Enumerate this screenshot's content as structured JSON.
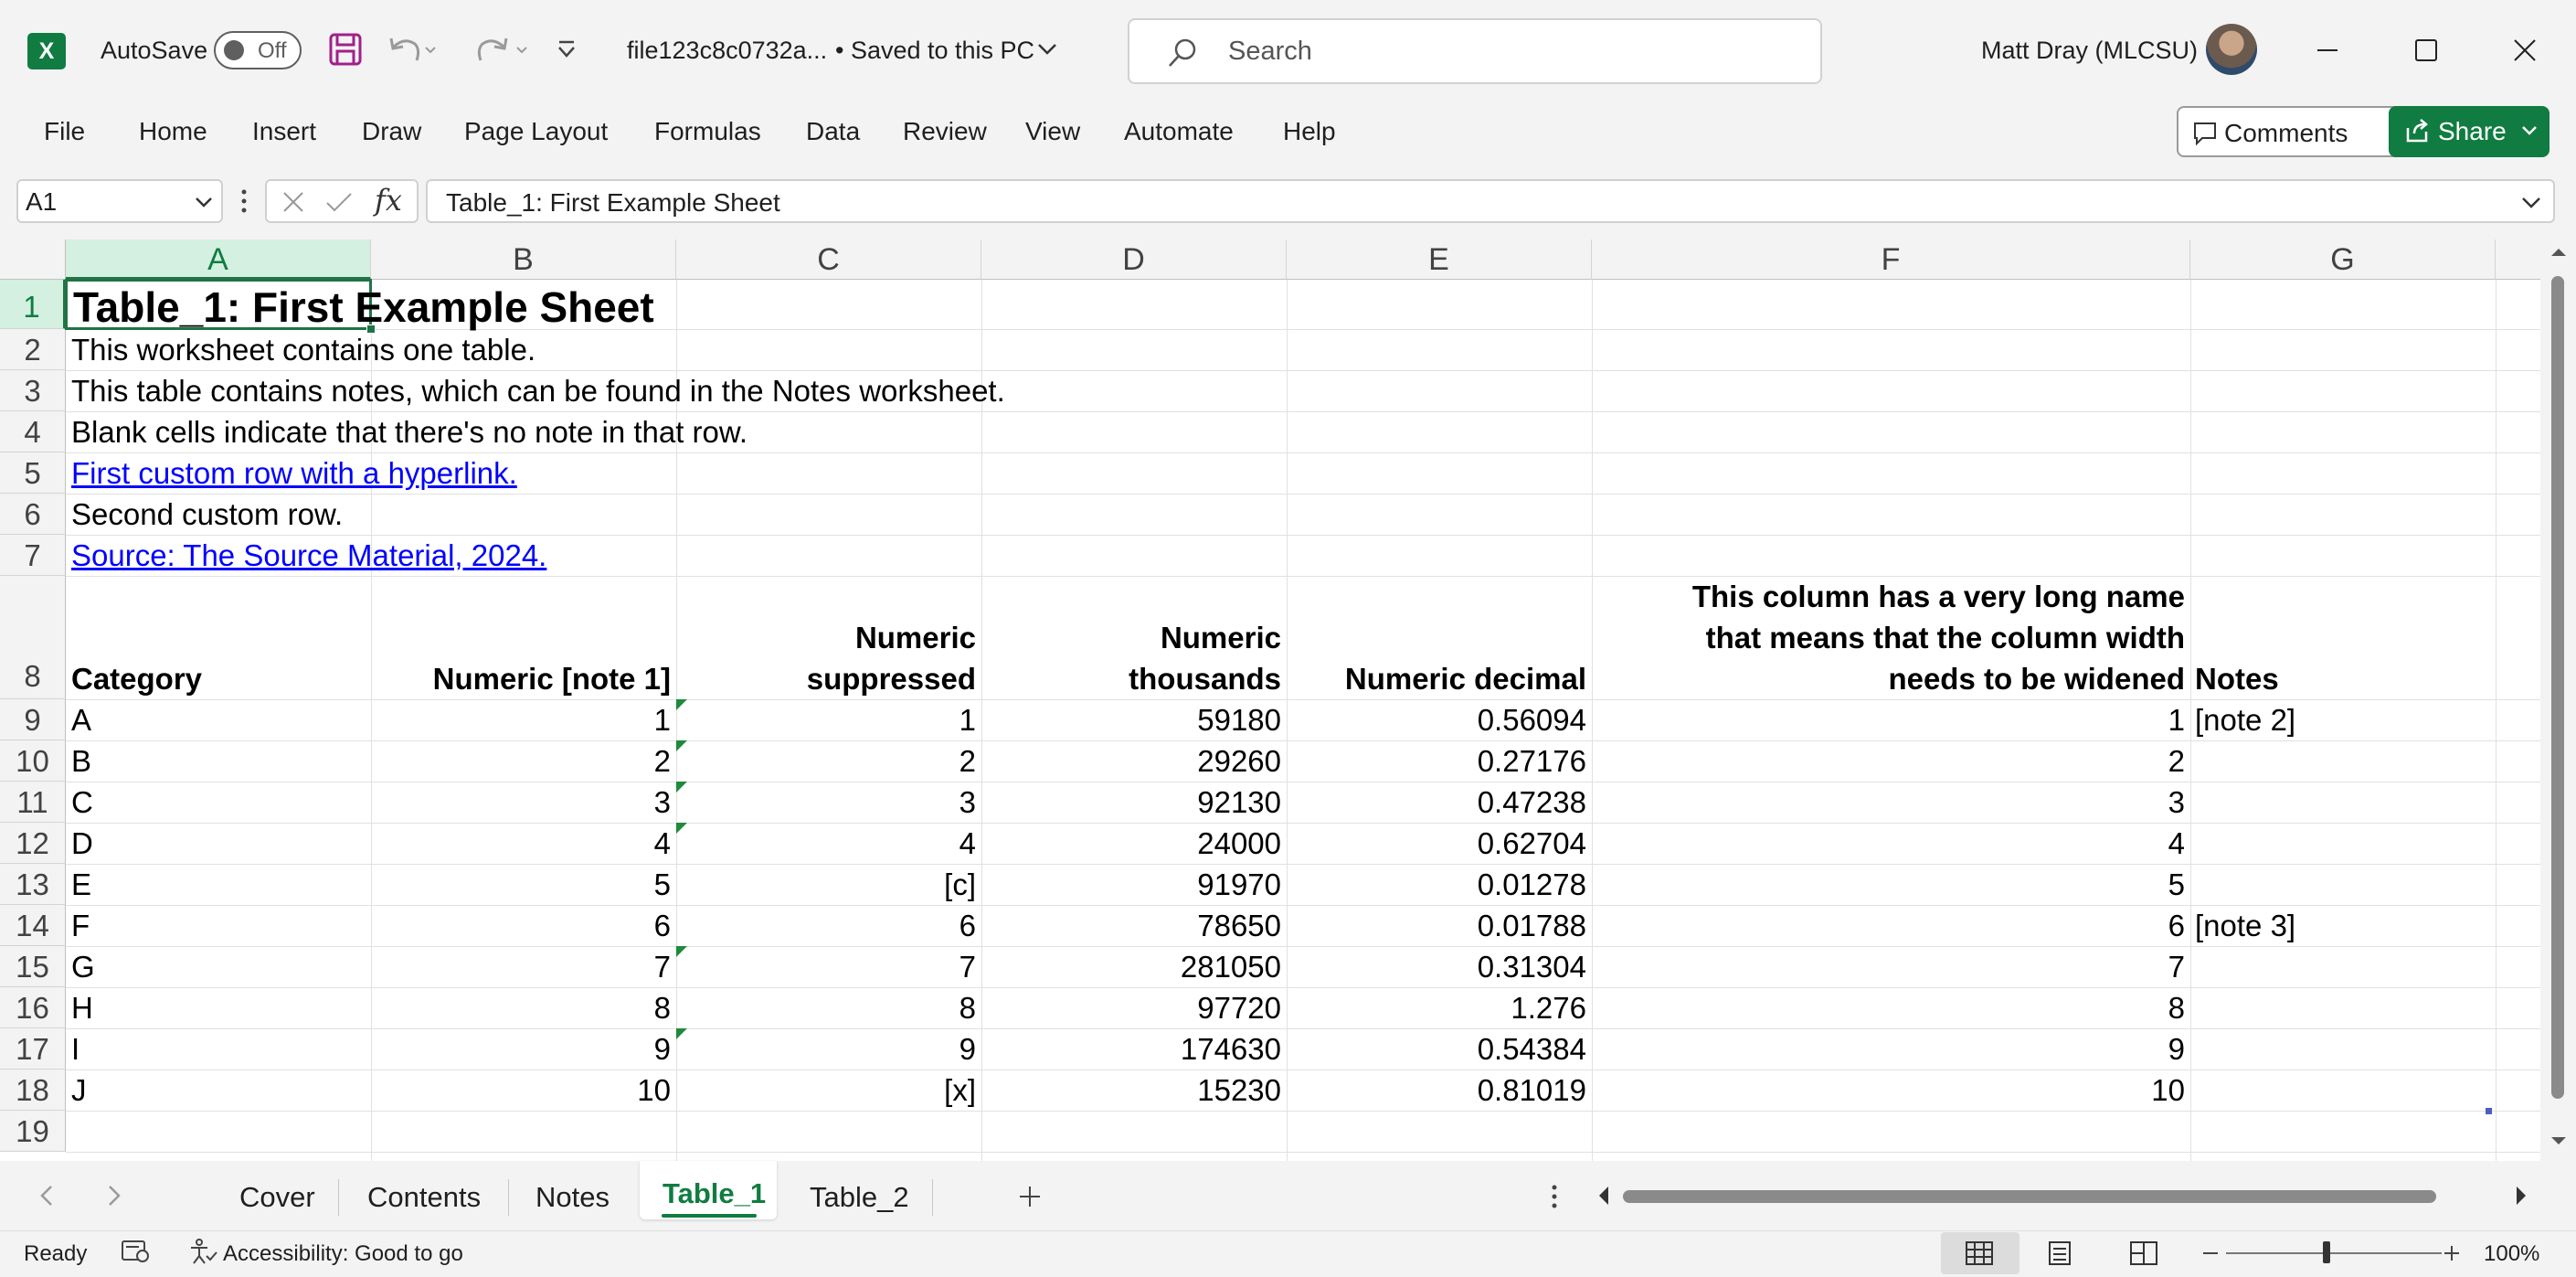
{
  "titlebar": {
    "autosave_label": "AutoSave",
    "toggle_state": "Off",
    "file_name": "file123c8c0732a...",
    "save_status": "• Saved to this PC",
    "search_placeholder": "Search",
    "user_name": "Matt Dray (MLCSU)"
  },
  "ribbon": {
    "tabs": [
      "File",
      "Home",
      "Insert",
      "Draw",
      "Page Layout",
      "Formulas",
      "Data",
      "Review",
      "View",
      "Automate",
      "Help"
    ],
    "comments_label": "Comments",
    "share_label": "Share"
  },
  "formula_bar": {
    "name_box": "A1",
    "fx_label": "fx",
    "formula": "Table_1: First Example Sheet"
  },
  "grid": {
    "columns": [
      "A",
      "B",
      "C",
      "D",
      "E",
      "F",
      "G"
    ],
    "rows": [
      "1",
      "2",
      "3",
      "4",
      "5",
      "6",
      "7",
      "8",
      "9",
      "10",
      "11",
      "12",
      "13",
      "14",
      "15",
      "16",
      "17",
      "18",
      "19"
    ],
    "title": "Table_1: First Example Sheet",
    "lines": [
      "This worksheet contains one table.",
      "This table contains notes, which can be found in the Notes worksheet.",
      "Blank cells indicate that there's no note in that row."
    ],
    "link1": "First custom row with a hyperlink.",
    "line6": "Second custom row.",
    "link2": "Source: The Source Material, 2024.",
    "headers": {
      "category": "Category",
      "numeric": "Numeric [note 1]",
      "suppressed_1": "Numeric",
      "suppressed_2": "suppressed",
      "thousands_1": "Numeric",
      "thousands_2": "thousands",
      "decimal": "Numeric decimal",
      "long_1": "This column has a very long name",
      "long_2": "that means that the column width",
      "long_3": "needs to be widened",
      "notes": "Notes"
    },
    "data": [
      {
        "category": "A",
        "numeric": "1",
        "suppressed": "1",
        "thousands": "59180",
        "decimal": "0.56094",
        "long": "1",
        "notes": "[note 2]"
      },
      {
        "category": "B",
        "numeric": "2",
        "suppressed": "2",
        "thousands": "29260",
        "decimal": "0.27176",
        "long": "2",
        "notes": ""
      },
      {
        "category": "C",
        "numeric": "3",
        "suppressed": "3",
        "thousands": "92130",
        "decimal": "0.47238",
        "long": "3",
        "notes": ""
      },
      {
        "category": "D",
        "numeric": "4",
        "suppressed": "4",
        "thousands": "24000",
        "decimal": "0.62704",
        "long": "4",
        "notes": ""
      },
      {
        "category": "E",
        "numeric": "5",
        "suppressed": "[c]",
        "thousands": "91970",
        "decimal": "0.01278",
        "long": "5",
        "notes": ""
      },
      {
        "category": "F",
        "numeric": "6",
        "suppressed": "6",
        "thousands": "78650",
        "decimal": "0.01788",
        "long": "6",
        "notes": "[note 3]"
      },
      {
        "category": "G",
        "numeric": "7",
        "suppressed": "7",
        "thousands": "281050",
        "decimal": "0.31304",
        "long": "7",
        "notes": ""
      },
      {
        "category": "H",
        "numeric": "8",
        "suppressed": "8",
        "thousands": "97720",
        "decimal": "1.276",
        "long": "8",
        "notes": ""
      },
      {
        "category": "I",
        "numeric": "9",
        "suppressed": "9",
        "thousands": "174630",
        "decimal": "0.54384",
        "long": "9",
        "notes": ""
      },
      {
        "category": "J",
        "numeric": "10",
        "suppressed": "[x]",
        "thousands": "15230",
        "decimal": "0.81019",
        "long": "10",
        "notes": ""
      }
    ]
  },
  "sheet_tabs": {
    "tabs": [
      "Cover",
      "Contents",
      "Notes",
      "Table_1",
      "Table_2"
    ],
    "active": "Table_1"
  },
  "status": {
    "ready": "Ready",
    "accessibility": "Accessibility: Good to go",
    "zoom": "100%"
  },
  "colors": {
    "excel_green": "#107c41",
    "link_blue": "#0000ff",
    "selection_green": "#217346"
  },
  "icons": [
    "excel-icon",
    "save-icon",
    "undo-icon",
    "redo-icon",
    "customize-qat-icon",
    "chevron-down-icon",
    "search-icon",
    "minimize-icon",
    "maximize-icon",
    "close-icon",
    "comment-icon",
    "share-icon",
    "cancel-icon",
    "enter-icon",
    "function-icon",
    "add-sheet-icon",
    "more-icon",
    "normal-view-icon",
    "page-layout-icon",
    "page-break-icon",
    "macro-icon",
    "accessibility-icon"
  ]
}
